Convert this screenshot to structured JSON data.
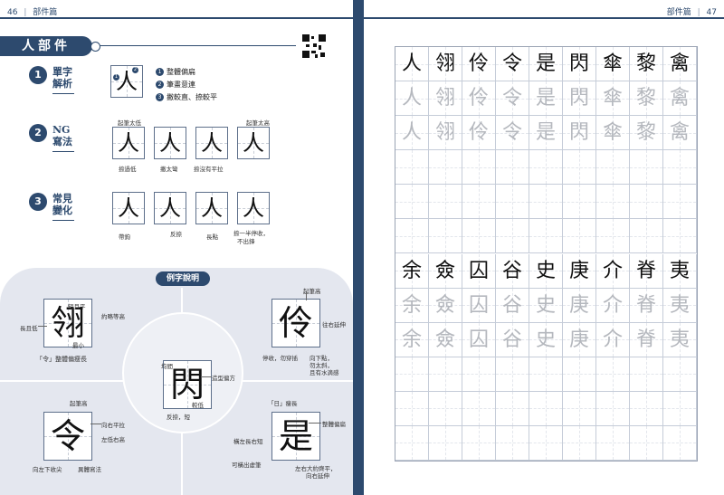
{
  "header": {
    "left_page_number": "46",
    "left_section": "部件篇",
    "right_section": "部件篇",
    "right_page_number": "47"
  },
  "title": "人部件",
  "sections": [
    {
      "number": "1",
      "label_line1": "單字",
      "label_line2": "解析"
    },
    {
      "number": "2",
      "label_line1": "NG",
      "label_line2": "寫法"
    },
    {
      "number": "3",
      "label_line1": "常見",
      "label_line2": "變化"
    }
  ],
  "analysis": {
    "char": "人",
    "mark1": "1",
    "mark2": "2",
    "points": [
      {
        "num": "1",
        "text": "整體偏扁"
      },
      {
        "num": "2",
        "text": "筆畫意連"
      },
      {
        "num": "3",
        "text": "撇較直、捺較平"
      }
    ]
  },
  "ng": {
    "chars": [
      "人",
      "人",
      "人",
      "人"
    ],
    "top_notes": [
      "起筆太低",
      "起筆太高"
    ],
    "bottom_notes": [
      "捺過低",
      "撇太彎",
      "捺沒有平拉"
    ]
  },
  "variations": {
    "chars": [
      "人",
      "人",
      "人",
      "人"
    ],
    "notes": [
      "帶鉤",
      "反捺",
      "長點",
      "捺一半停收，",
      "不出鋒"
    ]
  },
  "explanation": {
    "title": "例字說明",
    "examples": [
      {
        "char": "翎",
        "notes": [
          "短且平",
          "約略等高",
          "長且低",
          "最小"
        ],
        "caption": "「令」整體偏瘦長"
      },
      {
        "char": "伶",
        "notes": [
          "起筆高",
          "往右延伸",
          "停收，勿穿插",
          "向下點，",
          "勿太斜，",
          "且有水滴感"
        ],
        "caption": ""
      },
      {
        "char": "閃",
        "notes": [
          "均間",
          "造型偏方",
          "較低",
          "反捺，短"
        ],
        "caption": ""
      },
      {
        "char": "令",
        "notes": [
          "起筆高",
          "向右平拉",
          "左低右高",
          "向左下收尖",
          "異體寫法"
        ],
        "caption": ""
      },
      {
        "char": "是",
        "notes": [
          "「日」瘦長",
          "整體偏扁",
          "橫左長右短",
          "可橫出虛筆",
          "左右大約齊平，",
          "向右延伸"
        ],
        "caption": ""
      }
    ]
  },
  "practice": {
    "row1": [
      "人",
      "翎",
      "伶",
      "令",
      "是",
      "閃",
      "傘",
      "黎",
      "禽"
    ],
    "row2": [
      "余",
      "僉",
      "囚",
      "谷",
      "史",
      "庚",
      "介",
      "脊",
      "夷"
    ]
  },
  "colors": {
    "navy": "#2d4a6e",
    "light": "#e4e7ef"
  }
}
